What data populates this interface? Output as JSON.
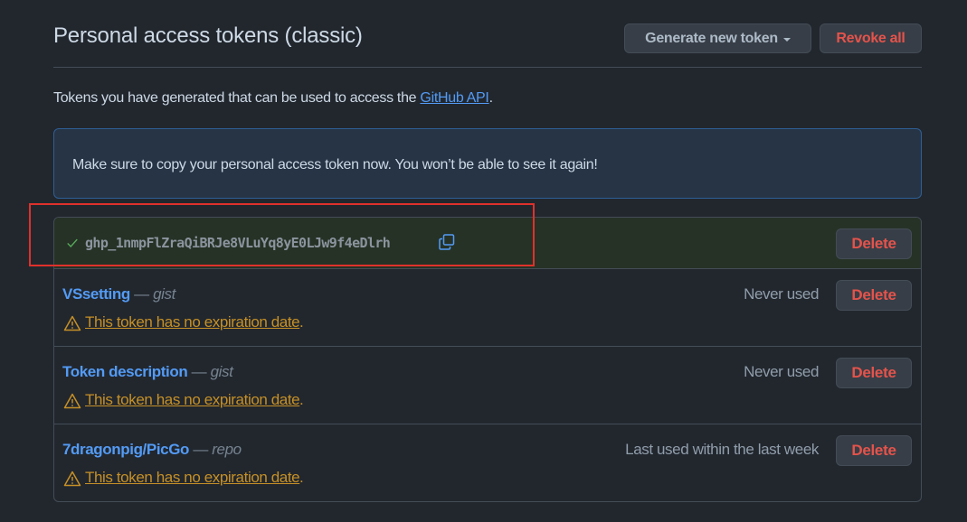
{
  "header": {
    "title": "Personal access tokens (classic)",
    "generate_label": "Generate new token",
    "revoke_label": "Revoke all"
  },
  "intro": {
    "text": "Tokens you have generated that can be used to access the ",
    "link": "GitHub API",
    "suffix": "."
  },
  "flash": {
    "message": "Make sure to copy your personal access token now. You won’t be able to see it again!"
  },
  "new_token": {
    "value": "ghp_1nmpFlZraQiBRJe8VLuYq8yE0LJw9f4eDlrh",
    "delete_label": "Delete"
  },
  "tokens": [
    {
      "name": "VSsetting",
      "separator": " — ",
      "scope": "gist",
      "last_used": "Never used",
      "warning": "This token has no expiration date",
      "delete_label": "Delete"
    },
    {
      "name": "Token description",
      "separator": " — ",
      "scope": "gist",
      "last_used": "Never used",
      "warning": "This token has no expiration date",
      "delete_label": "Delete"
    },
    {
      "name": "7dragonpig/PicGo",
      "separator": " — ",
      "scope": "repo",
      "last_used": "Last used within the last week",
      "warning": "This token has no expiration date",
      "delete_label": "Delete"
    }
  ],
  "colors": {
    "background": "#22272e",
    "link": "#539bf5",
    "danger": "#e5534b",
    "warning": "#c69026",
    "success": "#57ab5a",
    "highlight": "#e0312b"
  }
}
